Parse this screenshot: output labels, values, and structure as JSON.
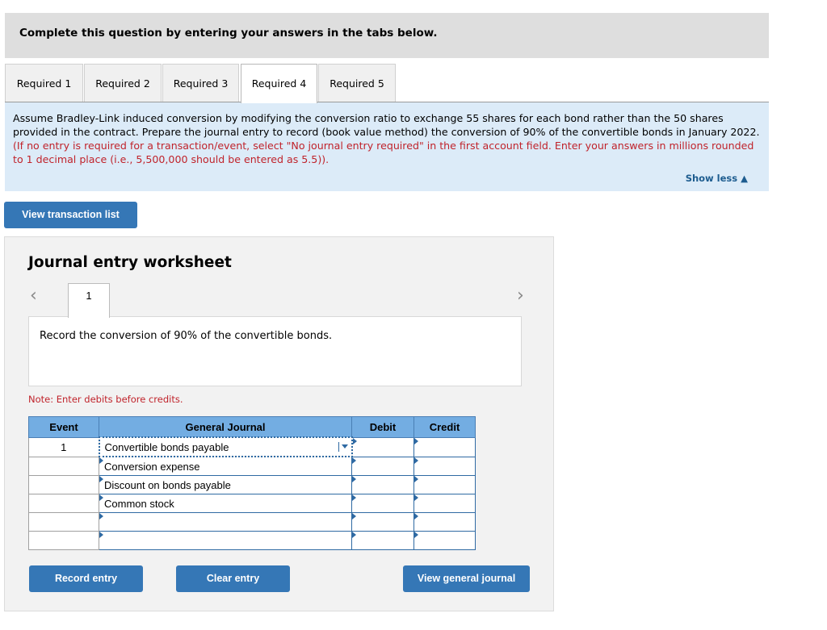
{
  "header": {
    "instruction": "Complete this question by entering your answers in the tabs below."
  },
  "tabs": [
    {
      "label": "Required 1",
      "active": false
    },
    {
      "label": "Required 2",
      "active": false
    },
    {
      "label": "Required 3",
      "active": false
    },
    {
      "label": "Required 4",
      "active": true
    },
    {
      "label": "Required 5",
      "active": false
    }
  ],
  "question": {
    "text": "Assume Bradley-Link induced conversion by modifying the conversion ratio to exchange 55 shares for each bond rather than the 50 shares provided in the contract. Prepare the journal entry to record (book value method) the conversion of 90% of the convertible bonds in January 2022.",
    "instruction_red": "(If no entry is required for a transaction/event, select \"No journal entry required\" in the first account field. Enter your answers in millions rounded to 1 decimal place (i.e., 5,500,000 should be entered as 5.5)).",
    "show_less_label": "Show less",
    "show_less_icon": "▲"
  },
  "buttons": {
    "view_transaction_list": "View transaction list",
    "record_entry": "Record entry",
    "clear_entry": "Clear entry",
    "view_general_journal": "View general journal"
  },
  "worksheet": {
    "title": "Journal entry worksheet",
    "prev_icon": "‹",
    "next_icon": "›",
    "entry_tab": "1",
    "description": "Record the conversion of 90% of the convertible bonds.",
    "note": "Note: Enter debits before credits.",
    "columns": {
      "event": "Event",
      "general_journal": "General Journal",
      "debit": "Debit",
      "credit": "Credit"
    },
    "rows": [
      {
        "event": "1",
        "account": "Convertible bonds payable",
        "debit": "",
        "credit": ""
      },
      {
        "event": "",
        "account": "Conversion expense",
        "debit": "",
        "credit": ""
      },
      {
        "event": "",
        "account": "Discount on bonds payable",
        "debit": "",
        "credit": ""
      },
      {
        "event": "",
        "account": "Common stock",
        "debit": "",
        "credit": ""
      },
      {
        "event": "",
        "account": "",
        "debit": "",
        "credit": ""
      },
      {
        "event": "",
        "account": "",
        "debit": "",
        "credit": ""
      }
    ]
  }
}
